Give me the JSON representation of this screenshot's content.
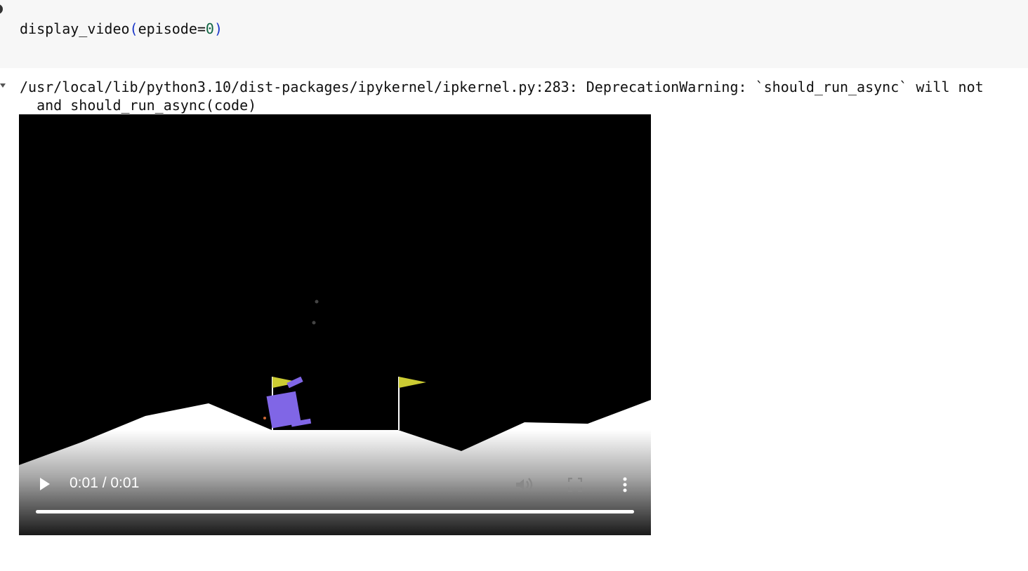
{
  "code_cell": {
    "fn": "display_video",
    "open_paren": "(",
    "arg_name": "episode=",
    "arg_value": "0",
    "close_paren": ")"
  },
  "output": {
    "stderr_line1": "/usr/local/lib/python3.10/dist-packages/ipykernel/ipkernel.py:283: DeprecationWarning: `should_run_async` will not",
    "stderr_line2": "  and should_run_async(code)"
  },
  "video": {
    "time_display": "0:01 / 0:01",
    "progress": 1.0,
    "icons": {
      "play": "play-icon",
      "volume": "volume-muted-icon",
      "fullscreen": "fullscreen-icon",
      "menu": "more-options-icon"
    },
    "colors": {
      "sky": "#000000",
      "terrain": "#ffffff",
      "flag": "#cccc33",
      "lander": "#8066e6"
    }
  }
}
